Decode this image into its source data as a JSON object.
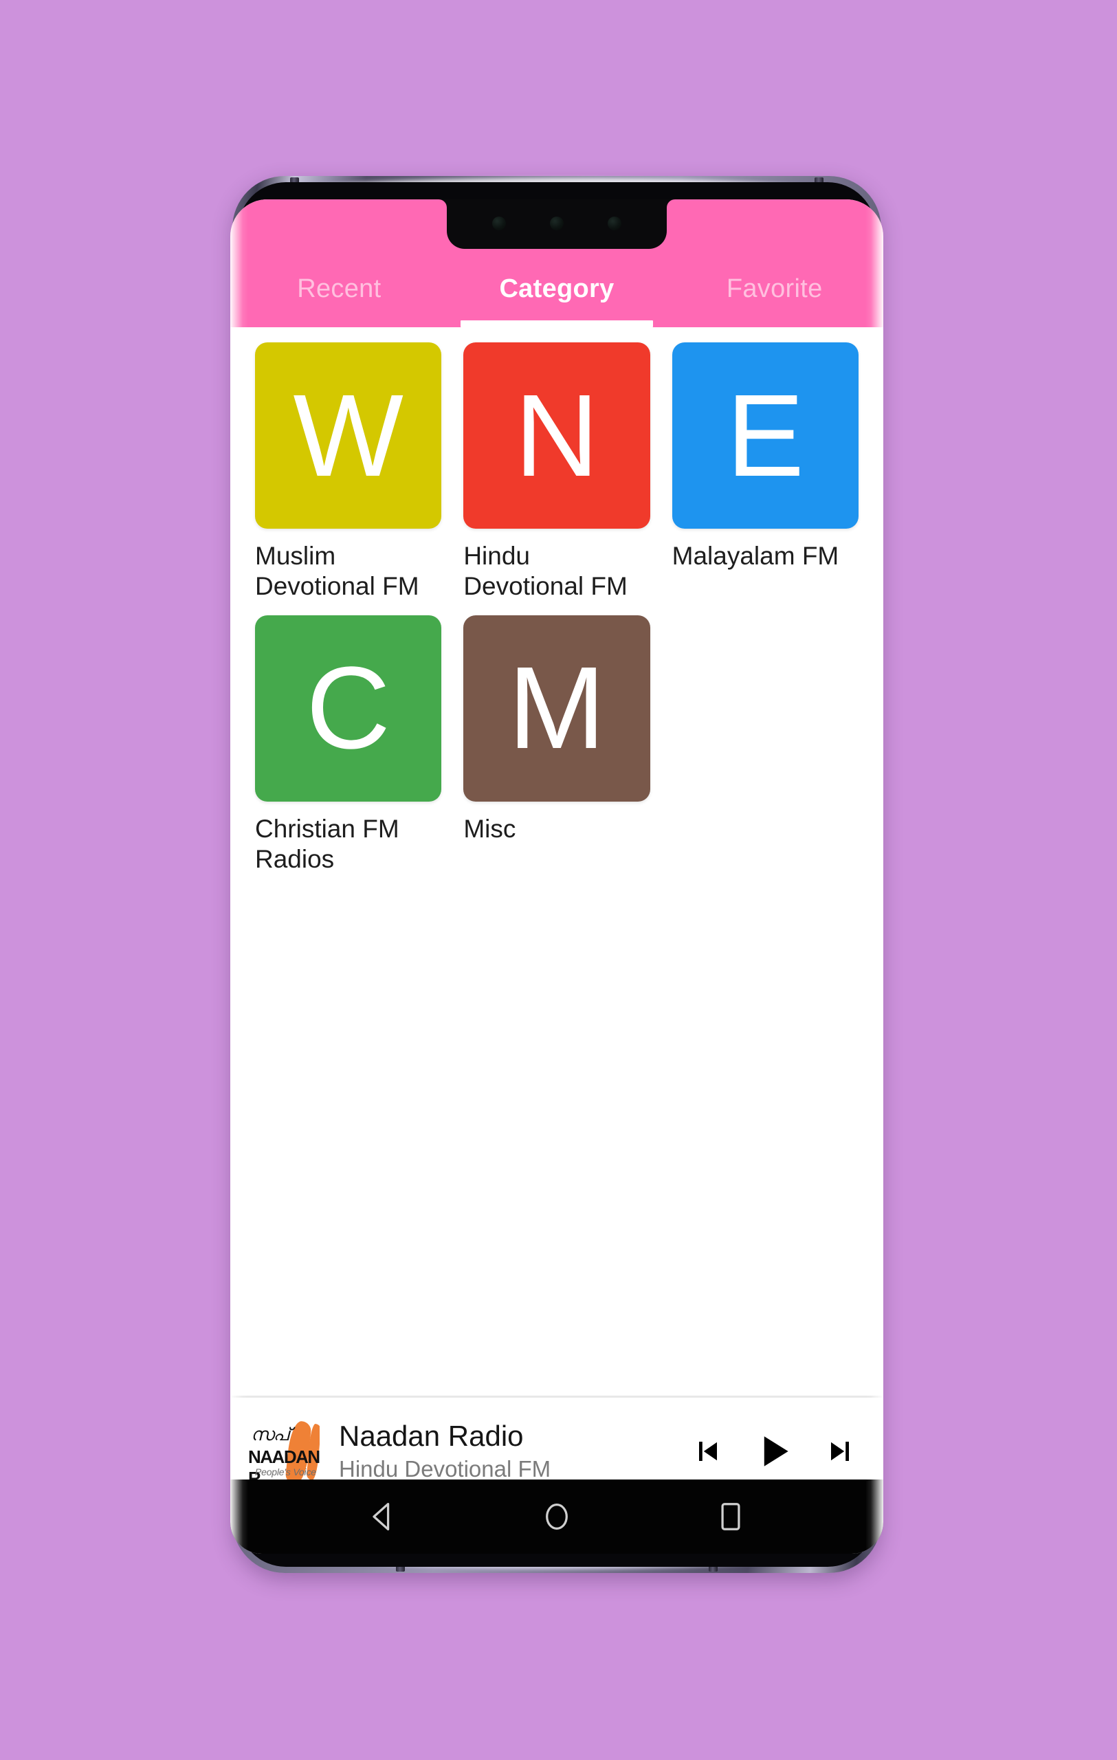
{
  "theme": {
    "page_background": "#cd92dc",
    "app_bar": "#ff69b4",
    "app_surface": "#ffffff",
    "primary_text": "#1d1d1d",
    "secondary_text": "#7b7b7b",
    "nav_bar": "#030303"
  },
  "tabs": {
    "items": [
      {
        "label": "Recent",
        "active": false
      },
      {
        "label": "Category",
        "active": true
      },
      {
        "label": "Favorite",
        "active": false
      }
    ]
  },
  "categories": [
    {
      "letter": "W",
      "label": "Muslim Devotional FM",
      "color": "#d4c800"
    },
    {
      "letter": "N",
      "label": "Hindu Devotional FM",
      "color": "#f03a2b"
    },
    {
      "letter": "E",
      "label": "Malayalam FM",
      "color": "#1e94ef"
    },
    {
      "letter": "C",
      "label": "Christian FM Radios",
      "color": "#45a94c"
    },
    {
      "letter": "M",
      "label": "Misc",
      "color": "#79584a"
    }
  ],
  "now_playing": {
    "title": "Naadan Radio",
    "subtitle": "Hindu Devotional FM",
    "logo": {
      "script": "സപ്",
      "word": "NAADAN R",
      "tagline": "People's Voice",
      "accent": "#ef8136"
    },
    "controls": [
      {
        "name": "previous",
        "icon": "skip-previous-icon"
      },
      {
        "name": "play",
        "icon": "play-icon"
      },
      {
        "name": "next",
        "icon": "skip-next-icon"
      }
    ]
  },
  "android_nav": {
    "buttons": [
      {
        "name": "back",
        "icon": "back-triangle-icon"
      },
      {
        "name": "home",
        "icon": "home-circle-icon"
      },
      {
        "name": "recents",
        "icon": "recents-square-icon"
      }
    ]
  }
}
